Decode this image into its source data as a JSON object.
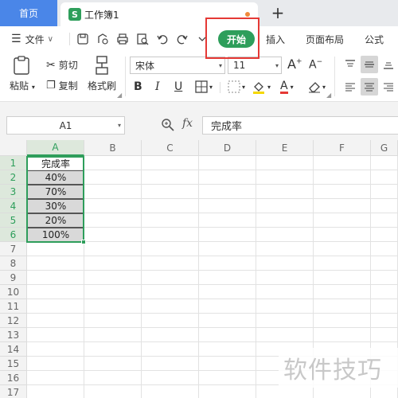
{
  "tabs": {
    "home_label": "首页",
    "doc_icon_letter": "S",
    "doc_label": "工作簿1",
    "new_tab_symbol": "+"
  },
  "menu": {
    "file_label": "文件",
    "start_label": "开始",
    "insert_label": "插入",
    "page_layout_label": "页面布局",
    "formula_label": "公式"
  },
  "toolbar": {
    "paste_label": "粘贴",
    "cut_label": "剪切",
    "copy_label": "复制",
    "format_painter_label": "格式刷",
    "font_name": "宋体",
    "font_size": "11",
    "grow_font": "A",
    "shrink_font": "A",
    "bold": "B",
    "italic": "I",
    "underline": "U",
    "font_color_letter": "A"
  },
  "formula_bar": {
    "name_box": "A1",
    "fx_label": "fx",
    "content": "完成率"
  },
  "grid": {
    "columns": [
      "A",
      "B",
      "C",
      "D",
      "E",
      "F",
      "G"
    ],
    "rows": [
      "1",
      "2",
      "3",
      "4",
      "5",
      "6",
      "7",
      "8",
      "9",
      "10",
      "11",
      "12",
      "13",
      "14",
      "15",
      "16",
      "17"
    ],
    "cells_a": [
      "完成率",
      "40%",
      "70%",
      "30%",
      "20%",
      "100%"
    ]
  },
  "watermark": "软件技巧",
  "colors": {
    "accent_green": "#2e9e5b",
    "home_tab_blue": "#4a86e8",
    "highlight_red": "#e53935"
  }
}
